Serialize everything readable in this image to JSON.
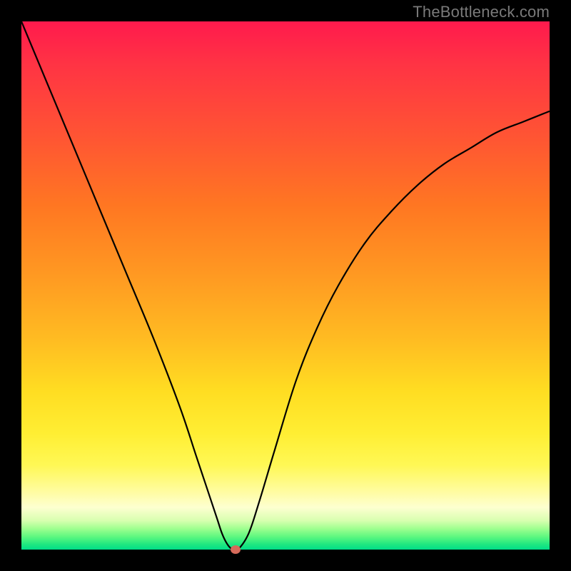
{
  "watermark": "TheBottleneck.com",
  "chart_data": {
    "type": "line",
    "title": "",
    "xlabel": "",
    "ylabel": "",
    "xlim": [
      0,
      100
    ],
    "ylim": [
      0,
      100
    ],
    "grid": false,
    "series": [
      {
        "name": "curve",
        "x": [
          0,
          5,
          10,
          15,
          20,
          25,
          30,
          33,
          35,
          37,
          38,
          39,
          40,
          41,
          43,
          45,
          48,
          52,
          56,
          60,
          65,
          70,
          75,
          80,
          85,
          90,
          95,
          100
        ],
        "values": [
          100,
          88,
          76,
          64,
          52,
          40,
          27,
          18,
          12,
          6,
          3,
          1,
          0,
          0,
          3,
          9,
          19,
          32,
          42,
          50,
          58,
          64,
          69,
          73,
          76,
          79,
          81,
          83
        ]
      }
    ],
    "annotations": [
      {
        "name": "min-marker",
        "x": 40.5,
        "y": 0,
        "color": "#d66a5a"
      }
    ]
  }
}
